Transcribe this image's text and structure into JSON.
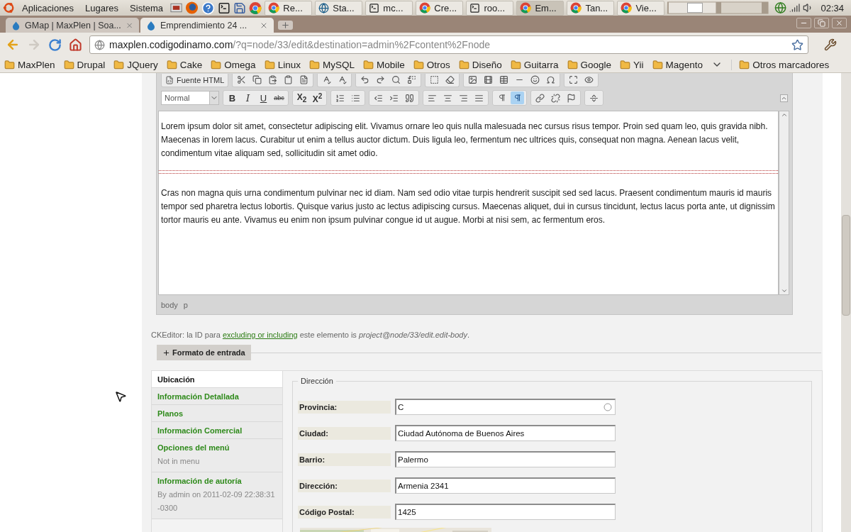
{
  "top_panel": {
    "menus": [
      "Aplicaciones",
      "Lugares",
      "Sistema"
    ],
    "tasks": [
      {
        "label": "Re...",
        "kind": "chrome",
        "selected": false
      },
      {
        "label": "Sta...",
        "kind": "globe",
        "selected": false
      },
      {
        "label": "mc...",
        "kind": "terminal",
        "selected": false
      },
      {
        "label": "Cre...",
        "kind": "chrome",
        "selected": false
      },
      {
        "label": "roo...",
        "kind": "terminal",
        "selected": false
      },
      {
        "label": "Em...",
        "kind": "chrome",
        "selected": true
      },
      {
        "label": "Tan...",
        "kind": "chrome",
        "selected": false
      },
      {
        "label": "Vie...",
        "kind": "chrome",
        "selected": false
      }
    ],
    "clock": "02:34"
  },
  "browser": {
    "tabs": [
      {
        "title": "GMap | MaxPlen | Soa...",
        "selected": false
      },
      {
        "title": "Emprendimiento 24 ...",
        "selected": true
      }
    ],
    "url": {
      "host": "maxplen.codigodinamo.com",
      "rest": "/?q=node/33/edit&destination=admin%2Fcontent%2Fnode"
    },
    "bookmarks": [
      "MaxPlen",
      "Drupal",
      "JQuery",
      "Cake",
      "Omega",
      "Linux",
      "MySQL",
      "Mobile",
      "Otros",
      "Diseño",
      "Guitarra",
      "Google",
      "Yii",
      "Magento"
    ],
    "other_bookmarks": "Otros marcadores"
  },
  "editor": {
    "source_button": "Fuente HTML",
    "format": "Normal",
    "style_buttons": [
      {
        "label": "B",
        "kind": "bold"
      },
      {
        "label": "I",
        "kind": "italic"
      },
      {
        "label": "U",
        "kind": "underline"
      },
      {
        "label": "abc",
        "kind": "strike"
      }
    ],
    "script_buttons": [
      "X$_{2}$",
      "X$^{2}$"
    ],
    "direction_buttons": [
      {
        "selected": false
      },
      {
        "selected": true
      }
    ],
    "paragraphs": [
      "Lorem ipsum dolor sit amet, consectetur adipiscing elit. Vivamus ornare leo quis nulla malesuada nec cursus risus tempor. Proin sed quam leo, quis gravida nibh. Maecenas in lorem lacus. Curabitur ut enim a tellus auctor dictum. Duis ligula leo, fermentum nec ultrices quis, consequat non magna. Aenean lacus velit, condimentum vitae aliquam sed, sollicitudin sit amet odio.",
      "Cras non magna quis urna condimentum pulvinar nec id diam. Nam sed odio vitae turpis hendrerit suscipit sed sed lacus. Praesent condimentum mauris id mauris tempor sed pharetra lectus lobortis. Quisque varius justo ac lectus adipiscing cursus. Maecenas aliquet, dui in cursus tincidunt, lectus lacus porta ante, ut dignissim tortor mauris eu ante. Vivamus eu enim non ipsum pulvinar congue id ut augue. Morbi at nisi sem, ac fermentum eros."
    ],
    "path": [
      "body",
      "p"
    ]
  },
  "note": {
    "text_before": "CKEditor: la ID para",
    "link": "excluding or including",
    "text_after": "este elemento is *project@node/33/edit.edit-body*."
  },
  "input_format": {
    "label": "Formato de entrada",
    "expanded": false
  },
  "vertical_tabs": [
    {
      "title": "Ubicación",
      "selected": true
    },
    {
      "title": "Información Detallada",
      "selected": false
    },
    {
      "title": "Planos",
      "selected": false
    },
    {
      "title": "Información Comercial",
      "selected": false
    },
    {
      "title": "Opciones del menú",
      "summary": "Not in menu",
      "selected": false
    },
    {
      "title": "Información de autoría",
      "summary": "By admin on 2011-02-09 22:38:31 -0300",
      "selected": false
    }
  ],
  "address": {
    "legend": "Dirección",
    "fields": [
      {
        "label": "Provincia:",
        "value": "C",
        "kind": "autocomplete"
      },
      {
        "label": "Ciudad:",
        "value": "Ciudad Autónoma de Buenos Aires",
        "kind": "text"
      },
      {
        "label": "Barrio:",
        "value": "Palermo",
        "kind": "text"
      },
      {
        "label": "Dirección:",
        "value": "Armenia 2341",
        "kind": "text"
      },
      {
        "label": "Código Postal:",
        "value": "1425",
        "kind": "text"
      }
    ]
  }
}
